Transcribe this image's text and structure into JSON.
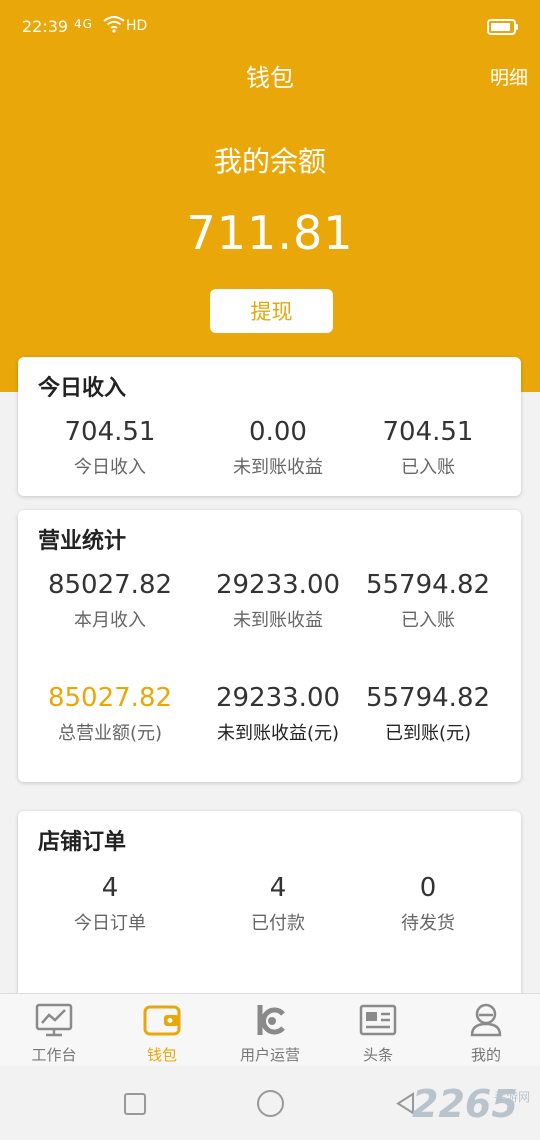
{
  "status_bar": {
    "time": "22:39",
    "signal": "4G",
    "network": "HD"
  },
  "header": {
    "title": "钱包",
    "detail_link": "明细"
  },
  "balance": {
    "label": "我的余额",
    "value": "711.81",
    "withdraw_label": "提现"
  },
  "today_income": {
    "title": "今日收入",
    "stats": [
      {
        "value": "704.51",
        "label": "今日收入"
      },
      {
        "value": "0.00",
        "label": "未到账收益"
      },
      {
        "value": "704.51",
        "label": "已入账"
      }
    ]
  },
  "business_stats": {
    "title": "营业统计",
    "month_stats": [
      {
        "value": "85027.82",
        "label": "本月收入"
      },
      {
        "value": "29233.00",
        "label": "未到账收益"
      },
      {
        "value": "55794.82",
        "label": "已入账"
      }
    ],
    "total_stats": [
      {
        "value": "85027.82",
        "label": "总营业额(元)"
      },
      {
        "value": "29233.00",
        "label": "未到账收益(元)"
      },
      {
        "value": "55794.82",
        "label": "已到账(元)"
      }
    ]
  },
  "shop_orders": {
    "title": "店铺订单",
    "stats": [
      {
        "value": "4",
        "label": "今日订单"
      },
      {
        "value": "4",
        "label": "已付款"
      },
      {
        "value": "0",
        "label": "待发货"
      }
    ]
  },
  "tabbar": {
    "items": [
      {
        "label": "工作台",
        "icon": "monitor-chart-icon"
      },
      {
        "label": "钱包",
        "icon": "wallet-icon"
      },
      {
        "label": "用户运营",
        "icon": "user-ops-icon"
      },
      {
        "label": "头条",
        "icon": "news-icon"
      },
      {
        "label": "我的",
        "icon": "profile-icon"
      }
    ]
  },
  "watermark": {
    "text": "2265",
    "sub": "手游网"
  },
  "colors": {
    "accent": "#e9a70a",
    "background": "#f2f2f2"
  }
}
